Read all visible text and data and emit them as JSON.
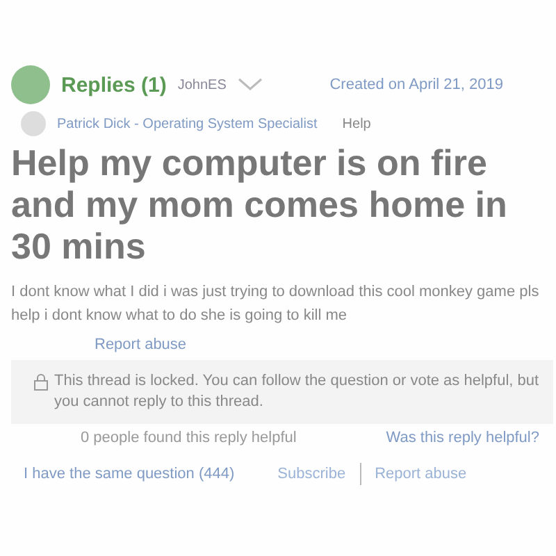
{
  "replies_header": {
    "label": "Replies (1)",
    "author": "JohnES"
  },
  "created": "Created on April 21, 2019",
  "question": {
    "title": "Help my computer is on fire and my mom comes home in 30 mins",
    "body": "I dont know what I did i was just trying to download this cool monkey game pls help i dont know what to do she is going to kill me"
  },
  "reply_overlay": {
    "author": "Patrick Dick - Operating System Specialist",
    "text": "Help",
    "report": "Report abuse",
    "helpful_count": "0 people found this reply helpful",
    "helpful_prompt": "Was this reply helpful?"
  },
  "locked_notice": "This thread is locked. You can follow the question or vote as helpful, but you cannot reply to this thread.",
  "footer": {
    "same_question": "I have the same question (444)",
    "subscribe": "Subscribe",
    "report": "Report abuse"
  }
}
